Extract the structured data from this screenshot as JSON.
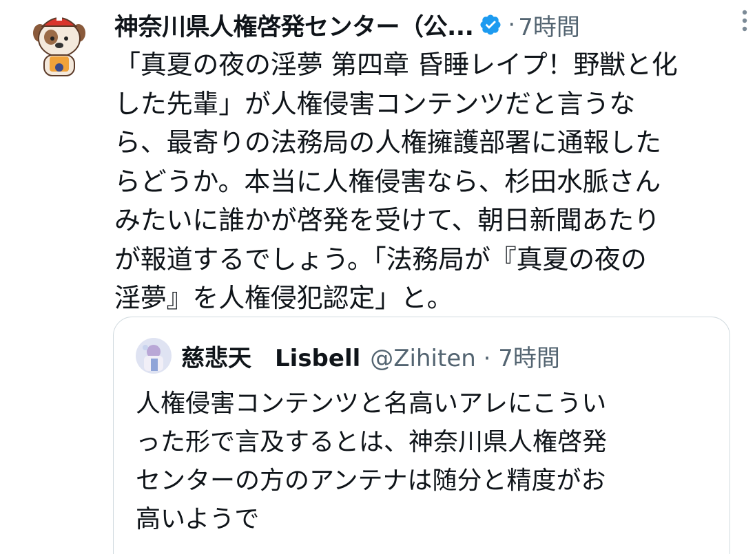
{
  "tweet": {
    "display_name": "神奈川県人権啓発センター（公...",
    "separator": "·",
    "time": "7時間",
    "body_lines": [
      "「真夏の夜の淫夢 第四章 昏睡レイプ！野獣と化",
      "した先輩」が人権侵害コンテンツだと言うな",
      "ら、最寄りの法務局の人権擁護部署に通報した",
      "らどうか。本当に人権侵害なら、杉田水脈さん",
      "みたいに誰かが啓発を受けて、朝日新聞あたり",
      "が報道するでしょう。「法務局が『真夏の夜の",
      "淫夢』を人権侵犯認定」と。"
    ]
  },
  "quote": {
    "display_name": "慈悲天　Lisbell",
    "handle_time": "@Zihiten · 7時間",
    "body_lines": [
      "人権侵害コンテンツと名高いアレにこうい",
      "った形で言及するとは、神奈川県人権啓発",
      "センターの方のアンテナは随分と精度がお",
      "高いようで"
    ]
  },
  "colors": {
    "text": "#0f1419",
    "secondary": "#536471",
    "verified": "#1d9bf0",
    "border": "#cfd9de"
  },
  "icons": {
    "verified": "verified-badge-icon",
    "more": "more-vertical-icon"
  }
}
